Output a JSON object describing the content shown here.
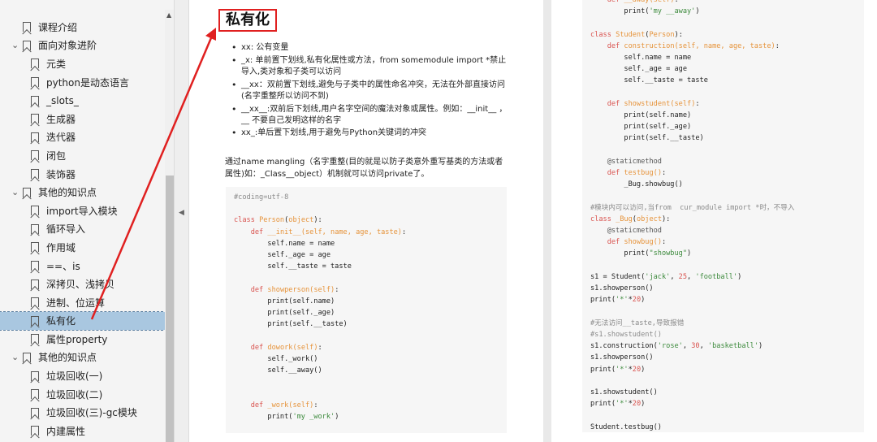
{
  "sidebar": {
    "top_glyphs": [
      "—",
      "│",
      "▢",
      "↻",
      "⚒"
    ],
    "items": [
      {
        "label": "课程介绍",
        "level": 1,
        "chevron": ""
      },
      {
        "label": "面向对象进阶",
        "level": 1,
        "chevron": "v"
      },
      {
        "label": "元类",
        "level": 2,
        "chevron": ""
      },
      {
        "label": "python是动态语言",
        "level": 2,
        "chevron": ""
      },
      {
        "label": "_slots_",
        "level": 2,
        "chevron": ""
      },
      {
        "label": "生成器",
        "level": 2,
        "chevron": ""
      },
      {
        "label": "迭代器",
        "level": 2,
        "chevron": ""
      },
      {
        "label": "闭包",
        "level": 2,
        "chevron": ""
      },
      {
        "label": "装饰器",
        "level": 2,
        "chevron": ""
      },
      {
        "label": "其他的知识点",
        "level": 1,
        "chevron": "v"
      },
      {
        "label": "import导入模块",
        "level": 2,
        "chevron": ""
      },
      {
        "label": "循环导入",
        "level": 2,
        "chevron": ""
      },
      {
        "label": "作用域",
        "level": 2,
        "chevron": ""
      },
      {
        "label": "==、is",
        "level": 2,
        "chevron": ""
      },
      {
        "label": "深拷贝、浅拷贝",
        "level": 2,
        "chevron": ""
      },
      {
        "label": "进制、位运算",
        "level": 2,
        "chevron": ""
      },
      {
        "label": "私有化",
        "level": 2,
        "chevron": "",
        "selected": true
      },
      {
        "label": "属性property",
        "level": 2,
        "chevron": ""
      },
      {
        "label": "其他的知识点",
        "level": 1,
        "chevron": "v"
      },
      {
        "label": "垃圾回收(一)",
        "level": 2,
        "chevron": ""
      },
      {
        "label": "垃圾回收(二)",
        "level": 2,
        "chevron": ""
      },
      {
        "label": "垃圾回收(三)-gc模块",
        "level": 2,
        "chevron": ""
      },
      {
        "label": "内建属性",
        "level": 2,
        "chevron": ""
      }
    ]
  },
  "main": {
    "title": "私有化",
    "bullets": [
      "xx: 公有变量",
      "_x: 单前置下划线,私有化属性或方法，from somemodule import *禁止导入,类对象和子类可以访问",
      "__xx：双前置下划线,避免与子类中的属性命名冲突，无法在外部直接访问(名字重整所以访问不到)",
      "__xx__:双前后下划线,用户名字空间的魔法对象或属性。例如：__init__ ，__ 不要自己发明这样的名字",
      "xx_:单后置下划线,用于避免与Python关键词的冲突"
    ],
    "paragraph": "通过name mangling（名字重整(目的就是以防子类意外重写基类的方法或者属性)如：_Class__object）机制就可以访问private了。"
  },
  "accent": {
    "arrow_color": "#e02020",
    "selected_bg": "#a9c7e0"
  }
}
